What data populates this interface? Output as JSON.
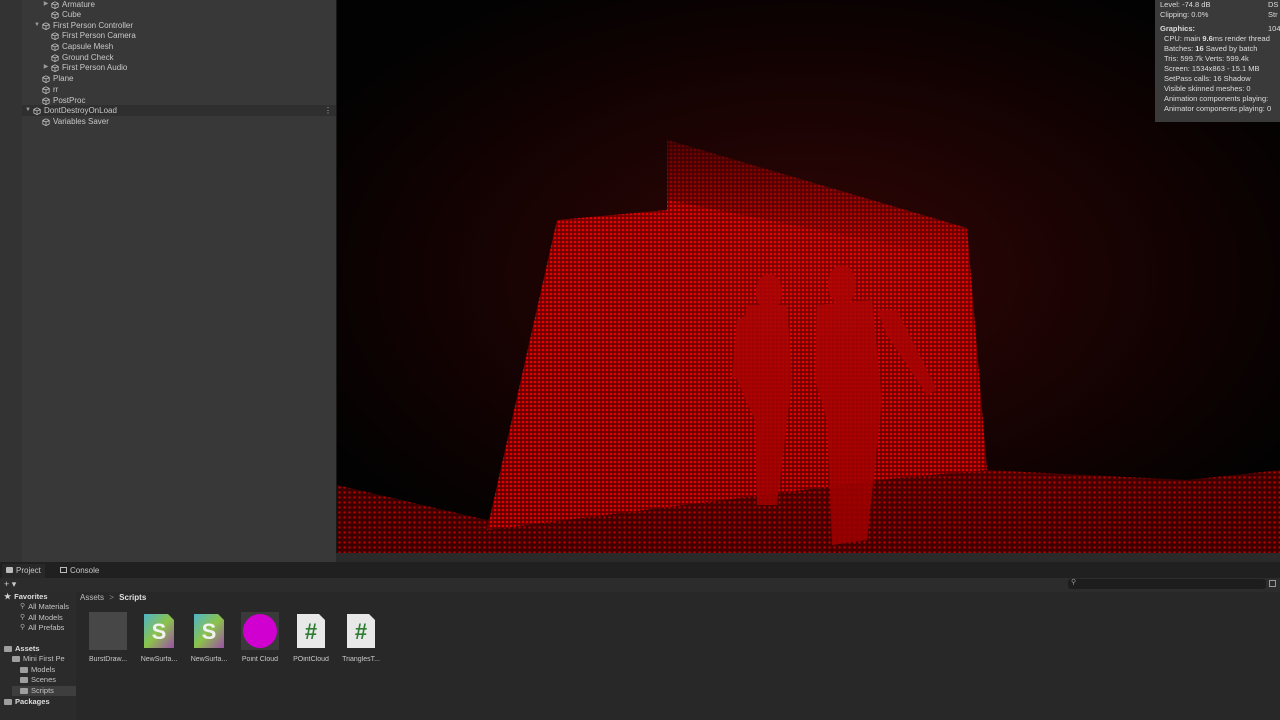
{
  "hierarchy": {
    "items": [
      {
        "label": "Armature",
        "indent": 2,
        "arrow": "▶"
      },
      {
        "label": "Cube",
        "indent": 2,
        "arrow": ""
      },
      {
        "label": "First Person Controller",
        "indent": 1,
        "arrow": "▼"
      },
      {
        "label": "First Person Camera",
        "indent": 2,
        "arrow": ""
      },
      {
        "label": "Capsule Mesh",
        "indent": 2,
        "arrow": ""
      },
      {
        "label": "Ground Check",
        "indent": 2,
        "arrow": ""
      },
      {
        "label": "First Person Audio",
        "indent": 2,
        "arrow": "▶"
      },
      {
        "label": "Plane",
        "indent": 1,
        "arrow": ""
      },
      {
        "label": "rr",
        "indent": 1,
        "arrow": ""
      },
      {
        "label": "PostProc",
        "indent": 1,
        "arrow": ""
      },
      {
        "label": "DontDestroyOnLoad",
        "indent": 0,
        "arrow": "▼"
      },
      {
        "label": "Variables Saver",
        "indent": 1,
        "arrow": ""
      }
    ]
  },
  "stats": {
    "level": "Level: -74.8 dB",
    "level_right": "DS",
    "clipping": "Clipping: 0.0%",
    "clipping_right": "Str",
    "graphics_heading": "Graphics:",
    "graphics_right": "104",
    "cpu_prefix": "CPU: main ",
    "cpu_value": "9.6",
    "cpu_suffix": "ms  render thread",
    "batches_prefix": "Batches: ",
    "batches_value": "16",
    "batches_suffix": "     Saved by batch",
    "tris": "Tris: 599.7k      Verts: 599.4k",
    "screen": "Screen: 1534x863 - 15.1 MB",
    "setpass": "SetPass calls: 16          Shadow",
    "skinned": "Visible skinned meshes: 0",
    "animation": "Animation components playing:",
    "animator": "Animator components playing: 0"
  },
  "bottom": {
    "tabs": [
      {
        "label": "Project",
        "active": true
      },
      {
        "label": "Console",
        "active": false
      }
    ],
    "add_label": "+ ▾",
    "tree": [
      {
        "label": "Favorites",
        "bold": true,
        "icon": "star-icon"
      },
      {
        "label": "All Materials",
        "icon": "search-icon"
      },
      {
        "label": "All Models",
        "icon": "search-icon"
      },
      {
        "label": "All Prefabs",
        "icon": "search-icon"
      },
      {
        "label": "Assets",
        "bold": true,
        "icon": "folder-icon"
      },
      {
        "label": "Mini First Pe",
        "icon": "folder-icon"
      },
      {
        "label": "Models",
        "icon": "folder-icon"
      },
      {
        "label": "Scenes",
        "icon": "folder-icon"
      },
      {
        "label": "Scripts",
        "icon": "folder-icon",
        "selected": true
      },
      {
        "label": "Packages",
        "bold": true,
        "icon": "folder-icon"
      }
    ],
    "breadcrumb": {
      "root": "Assets",
      "sep": ">",
      "current": "Scripts"
    },
    "assets": [
      {
        "label": "BurstDraw...",
        "icon": "empty-thumb-icon"
      },
      {
        "label": "NewSurfa...",
        "icon": "shader-graph-icon"
      },
      {
        "label": "NewSurfa...",
        "icon": "shader-graph-icon"
      },
      {
        "label": "Point Cloud",
        "icon": "material-sphere-icon"
      },
      {
        "label": "POintCloud",
        "icon": "csharp-script-icon"
      },
      {
        "label": "TrianglesT...",
        "icon": "csharp-script-icon"
      }
    ]
  },
  "colors": {
    "point_cloud_red": "#d00000",
    "material_magenta": "#d000d0",
    "script_green": "#2e7d32"
  }
}
